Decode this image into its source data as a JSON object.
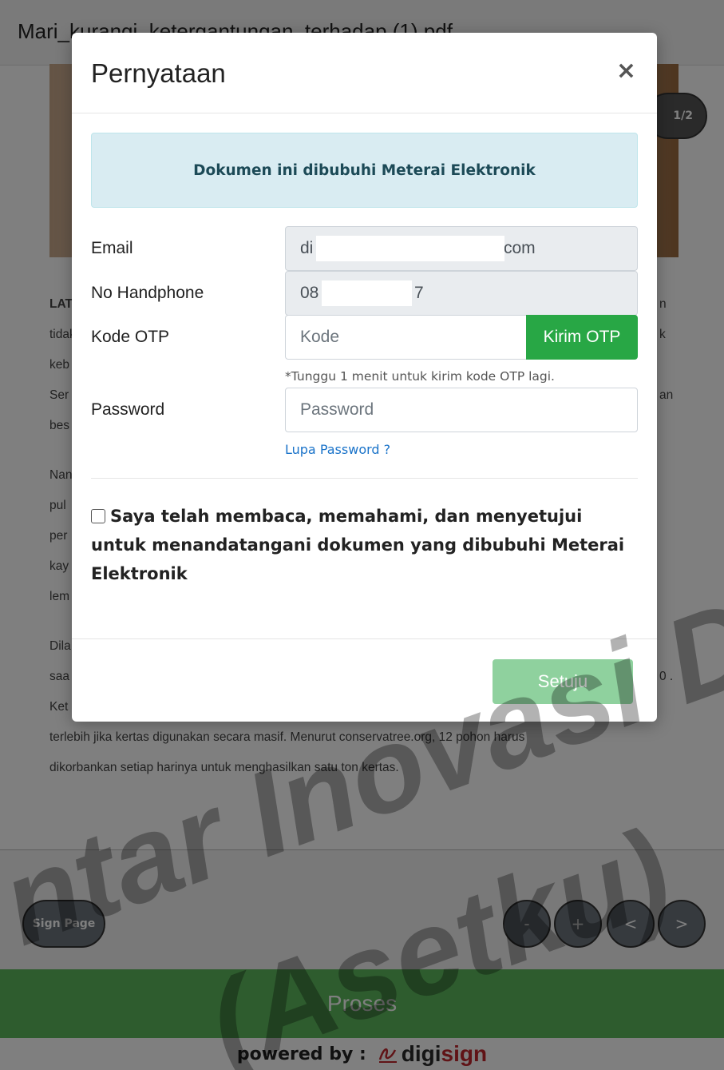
{
  "document": {
    "title": "Mari_kurangi_ketergantungan_terhadap (1).pdf",
    "page_indicator": "1/2",
    "lines": [
      "LATAR BELAKANG",
      "tidak",
      "keb",
      "Ser",
      "bes",
      "Nan",
      "pul",
      "per",
      "kay",
      "lem",
      "Dila",
      "saa",
      "Ket",
      "terlebih jika kertas digunakan secara masif. Menurut conservatree.org, 12 pohon harus",
      "dikorbankan setiap harinya  untuk menghasilkan satu ton kertas."
    ],
    "right_fragments": [
      "n",
      "k",
      "an",
      "0 ."
    ]
  },
  "toolbar": {
    "sign_page": "Sign Page",
    "zoom_out": "-",
    "zoom_in": "+",
    "prev": "<",
    "next": ">"
  },
  "proses_label": "Proses",
  "powered": {
    "text": "powered by :",
    "brand_a": "digi",
    "brand_b": "sign"
  },
  "watermark": {
    "line1": "ntar Inovasi D",
    "line2": "(Asetku)"
  },
  "modal": {
    "title": "Pernyataan",
    "close": "×",
    "alert": "Dokumen ini dibubuhi Meterai Elektronik",
    "email_label": "Email",
    "email_prefix": "di",
    "email_suffix": "com",
    "phone_label": "No Handphone",
    "phone_prefix": "08",
    "phone_suffix": "7",
    "otp_label": "Kode OTP",
    "otp_placeholder": "Kode",
    "otp_button": "Kirim OTP",
    "otp_hint": "*Tunggu 1 menit untuk kirim kode OTP lagi.",
    "password_label": "Password",
    "password_placeholder": "Password",
    "forgot_password": "Lupa Password ?",
    "agree_text": "Saya telah membaca, memahami, dan menyetujui untuk menandatangani dokumen yang dibubuhi Meterai Elektronik",
    "submit": "Setuju"
  },
  "colors": {
    "accent_green": "#28a745",
    "proses_green": "#5cb85c",
    "submit_disabled": "#8fd19e",
    "alert_bg": "#d9ecf2",
    "link": "#1a73c9",
    "brand_red": "#c0272d"
  }
}
